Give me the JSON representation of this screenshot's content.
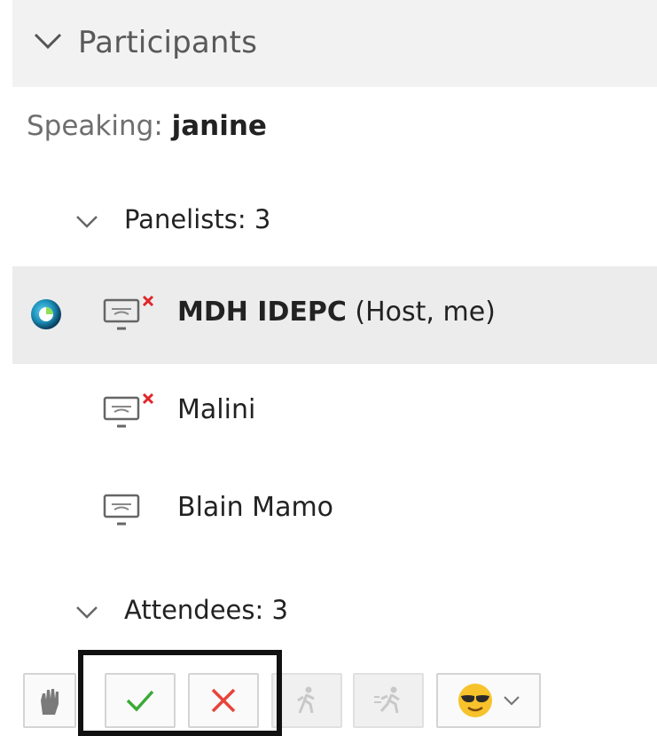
{
  "panel": {
    "title": "Participants",
    "speaking_label": "Speaking: ",
    "speaking_name": "janine"
  },
  "groups": {
    "panelists_label": "Panelists: 3",
    "attendees_label": "Attendees: 3"
  },
  "panelists": [
    {
      "name": "MDH IDEPC",
      "suffix": " (Host, me)",
      "icon": "screen-muted-icon",
      "presence": "webex-presence-icon"
    },
    {
      "name": "Malini",
      "suffix": "",
      "icon": "screen-muted-icon"
    },
    {
      "name": "Blain Mamo",
      "suffix": "",
      "icon": "screen-icon"
    }
  ],
  "toolbar": [
    {
      "name": "raise-hand-button",
      "icon": "raise-hand-icon",
      "enabled": true
    },
    {
      "name": "yes-button",
      "icon": "checkmark-icon",
      "enabled": true
    },
    {
      "name": "no-button",
      "icon": "x-icon",
      "enabled": true
    },
    {
      "name": "go-slower-button",
      "icon": "slow-walker-icon",
      "enabled": false
    },
    {
      "name": "go-faster-button",
      "icon": "fast-runner-icon",
      "enabled": false
    },
    {
      "name": "emoji-reactions-button",
      "icon": "sunglasses-emoji-icon",
      "enabled": true
    }
  ],
  "colors": {
    "check": "#3aaa35",
    "x": "#e8443a",
    "mute_x": "#e0262b"
  }
}
